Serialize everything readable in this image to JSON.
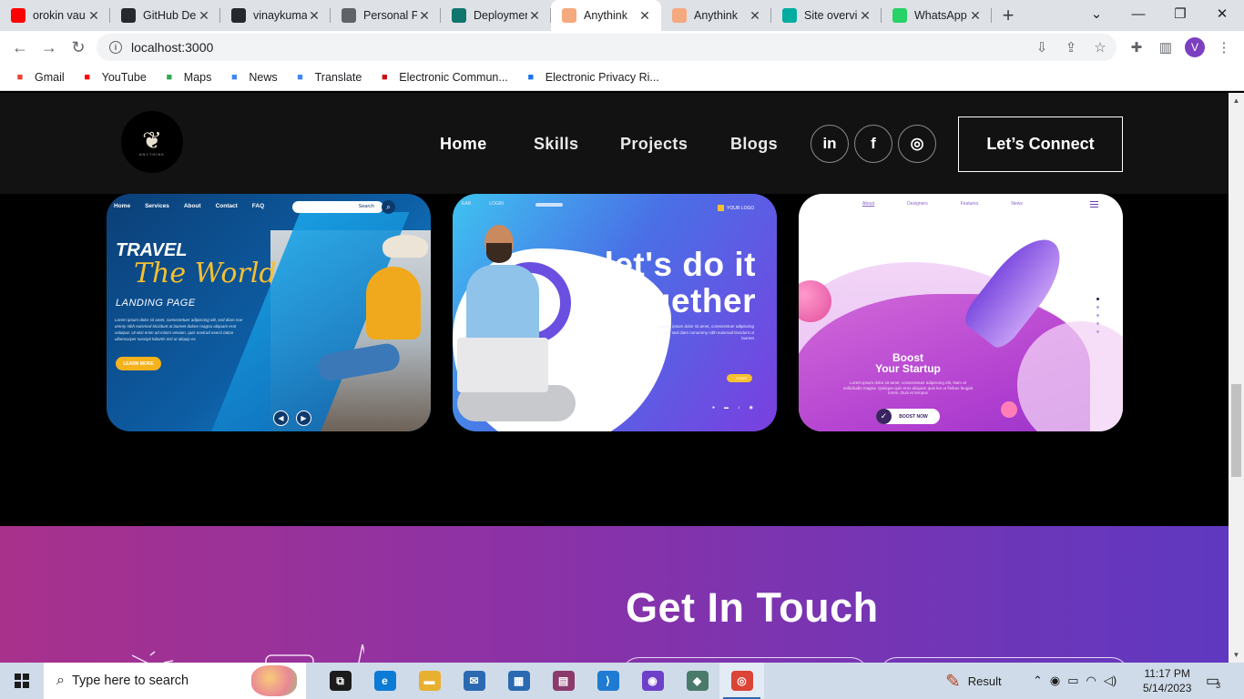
{
  "browser": {
    "tabs": [
      {
        "title": "orokin vau",
        "favicon_color": "#ff0000",
        "icon": "youtube-icon"
      },
      {
        "title": "GitHub De",
        "favicon_color": "#24292f",
        "icon": "github-icon"
      },
      {
        "title": "vinaykuma",
        "favicon_color": "#24292f",
        "icon": "github-icon"
      },
      {
        "title": "Personal P",
        "favicon_color": "#5f6368",
        "icon": "globe-icon"
      },
      {
        "title": "Deploymen",
        "favicon_color": "#0f766e",
        "icon": "react-icon"
      },
      {
        "title": "Anythink",
        "favicon_color": "#f5a97f",
        "icon": "b-icon"
      },
      {
        "title": "Anythink",
        "favicon_color": "#f5a97f",
        "icon": "b-icon"
      },
      {
        "title": "Site overvi",
        "favicon_color": "#00ad9f",
        "icon": "netlify-icon"
      },
      {
        "title": "WhatsApp",
        "favicon_color": "#25d366",
        "icon": "whatsapp-icon"
      }
    ],
    "active_tab_index": 5,
    "url": "localhost:3000",
    "avatar_letter": "V",
    "bookmarks": [
      {
        "label": "Gmail",
        "icon": "gmail-icon",
        "color": "#ea4335"
      },
      {
        "label": "YouTube",
        "icon": "youtube-icon",
        "color": "#ff0000"
      },
      {
        "label": "Maps",
        "icon": "maps-icon",
        "color": "#34a853"
      },
      {
        "label": "News",
        "icon": "news-icon",
        "color": "#4285f4"
      },
      {
        "label": "Translate",
        "icon": "translate-icon",
        "color": "#4285f4"
      },
      {
        "label": "Electronic Commun...",
        "icon": "opera-icon",
        "color": "#cc0f16"
      },
      {
        "label": "Electronic Privacy Ri...",
        "icon": "doc-icon",
        "color": "#1a73e8"
      }
    ]
  },
  "site": {
    "logo_text": "ANYTHINK",
    "nav": [
      "Home",
      "Skills",
      "Projects",
      "Blogs"
    ],
    "social": [
      {
        "label": "in",
        "icon": "linkedin-icon"
      },
      {
        "label": "f",
        "icon": "facebook-icon"
      },
      {
        "label": "◎",
        "icon": "instagram-icon"
      }
    ],
    "cta": "Let’s Connect",
    "projects": [
      {
        "menu": [
          "Home",
          "Services",
          "About",
          "Contact",
          "FAQ"
        ],
        "search_label": "Search",
        "title_line1": "TRAVEL",
        "title_line2": "The World",
        "subtitle": "LANDING PAGE",
        "body": "Lorem ipsum dolor sit amet, consectetuer adipiscing elit, sed diam non ummy nibh euismod tincidunt ut laoreet dolore magna aliquam erat volutpat. Ut wisi enim ad minim veniam, quis nostrud exerci tation ullamcorper suscipit lobortis nisl ut aliquip ex",
        "button": "LEARN MORE"
      },
      {
        "menu": [
          "EAR",
          "LOGIN"
        ],
        "logo_label": "YOUR LOGO",
        "headline": "let's do it together",
        "body": "Lorem ipsum dolor sit amet, consectetuer adipiscing elit, sed diam nonummy nibh euismod tincidunt ut laoreet",
        "button": "START",
        "socials": [
          "●",
          "▬",
          "♪",
          "◉"
        ]
      },
      {
        "menu": [
          "About",
          "Designers",
          "Features",
          "News"
        ],
        "headline_line1": "Boost",
        "headline_line2": "Your Startup",
        "body": "Lorem ipsum dolor sit amet, consectetuer adipiscing elit, Nam at sollicitudin magna. Quisque quis eros aliquam quis leo ut finibus feugiat lorem. Duis et tempus",
        "button": "BOOST NOW"
      }
    ],
    "contact_heading": "Get In Touch"
  },
  "taskbar": {
    "search_placeholder": "Type here to search",
    "apps": [
      {
        "icon": "task-view-icon",
        "color": "#1b1b1b",
        "glyph": "⧉"
      },
      {
        "icon": "edge-icon",
        "color": "#0c7bd6",
        "glyph": "e"
      },
      {
        "icon": "file-explorer-icon",
        "color": "#e8b030",
        "glyph": "▬"
      },
      {
        "icon": "mail-icon",
        "color": "#2b6ab1",
        "glyph": "✉"
      },
      {
        "icon": "store-icon",
        "color": "#2b6ab1",
        "glyph": "▦"
      },
      {
        "icon": "winrar-icon",
        "color": "#8b3a6b",
        "glyph": "▤"
      },
      {
        "icon": "vscode-icon",
        "color": "#1e7bd1",
        "glyph": "⟩"
      },
      {
        "icon": "github-desktop-icon",
        "color": "#6e40c9",
        "glyph": "◉"
      },
      {
        "icon": "git-icon",
        "color": "#4a7a6a",
        "glyph": "◆"
      },
      {
        "icon": "chrome-icon",
        "color": "#db4437",
        "glyph": "◎"
      }
    ],
    "active_app_index": 9,
    "result_label": "Result",
    "time": "11:17 PM",
    "date": "5/14/2023",
    "notifications": "3"
  }
}
